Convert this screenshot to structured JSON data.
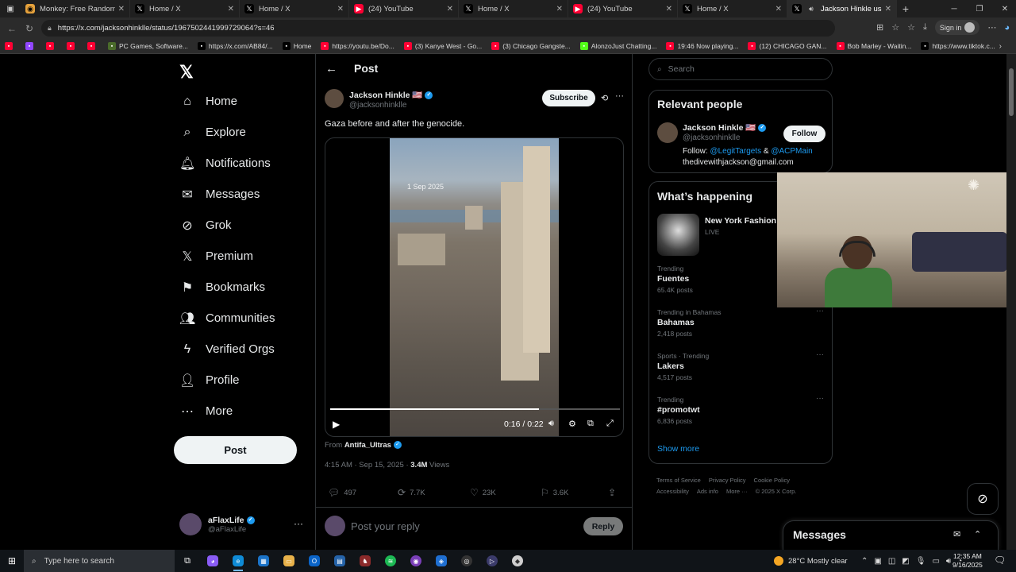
{
  "browser": {
    "tabs": [
      {
        "icon": "monkey-icon",
        "title": "Monkey: Free Random Vide",
        "active": false
      },
      {
        "icon": "x-icon",
        "title": "Home / X",
        "active": false
      },
      {
        "icon": "x-icon",
        "title": "Home / X",
        "active": false
      },
      {
        "icon": "youtube-icon",
        "title": "(24) YouTube",
        "active": false
      },
      {
        "icon": "x-icon",
        "title": "Home / X",
        "active": false
      },
      {
        "icon": "youtube-icon",
        "title": "(24) YouTube",
        "active": false
      },
      {
        "icon": "x-icon",
        "title": "Home / X",
        "active": false
      },
      {
        "icon": "x-icon",
        "title": "Jackson Hinkle us on X",
        "active": true
      }
    ],
    "url": "https://x.com/jacksonhinklle/status/1967502441999729064?s=46",
    "signin_label": "Sign in",
    "bookmarks": [
      {
        "label": "",
        "color": "#ff0033"
      },
      {
        "label": "",
        "color": "#9146ff"
      },
      {
        "label": "",
        "color": "#ff0033"
      },
      {
        "label": "",
        "color": "#ff0033"
      },
      {
        "label": "",
        "color": "#ff0033"
      },
      {
        "label": "PC Games, Software...",
        "color": "#4a6b2a"
      },
      {
        "label": "https://x.com/AB84/...",
        "color": "#000000"
      },
      {
        "label": "Home",
        "color": "#000000"
      },
      {
        "label": "https://youtu.be/Do...",
        "color": "#ff0033"
      },
      {
        "label": "(3) Kanye West - Go...",
        "color": "#ff0033"
      },
      {
        "label": "(3) Chicago Gangste...",
        "color": "#ff0033"
      },
      {
        "label": "AlonzoJust Chatting...",
        "color": "#53fc18"
      },
      {
        "label": "19:46 Now playing...",
        "color": "#ff0033"
      },
      {
        "label": "(12) CHICAGO GAN...",
        "color": "#ff0033"
      },
      {
        "label": "Bob Marley - Waitin...",
        "color": "#ff0033"
      },
      {
        "label": "https://www.tiktok.c...",
        "color": "#000000"
      }
    ]
  },
  "nav": {
    "items": [
      {
        "icon": "home-icon",
        "glyph": "⌂",
        "label": "Home"
      },
      {
        "icon": "explore-icon",
        "glyph": "⌕",
        "label": "Explore"
      },
      {
        "icon": "bell-icon",
        "glyph": "🔔︎",
        "label": "Notifications"
      },
      {
        "icon": "envelope-icon",
        "glyph": "✉",
        "label": "Messages"
      },
      {
        "icon": "grok-icon",
        "glyph": "⊘",
        "label": "Grok"
      },
      {
        "icon": "x-premium-icon",
        "glyph": "𝕏",
        "label": "Premium"
      },
      {
        "icon": "bookmark-icon",
        "glyph": "⚑",
        "label": "Bookmarks"
      },
      {
        "icon": "communities-icon",
        "glyph": "👥︎",
        "label": "Communities"
      },
      {
        "icon": "lightning-icon",
        "glyph": "ϟ",
        "label": "Verified Orgs"
      },
      {
        "icon": "profile-icon",
        "glyph": "👤︎",
        "label": "Profile"
      },
      {
        "icon": "more-icon",
        "glyph": "⋯",
        "label": "More"
      }
    ],
    "post_button": "Post",
    "account": {
      "name": "aFlaxLife",
      "handle": "@aFlaxLife"
    }
  },
  "post": {
    "header_title": "Post",
    "author_name": "Jackson Hinkle 🇺🇸",
    "author_handle": "@jacksonhinklle",
    "subscribe_label": "Subscribe",
    "text": "Gaza before and after the genocide.",
    "video": {
      "date_overlay": "1 Sep 2025",
      "time": "0:16 / 0:22",
      "progress": 0.72
    },
    "from_label": "From",
    "from_account": "Antifa_Ultras",
    "timestamp": "4:15 AM · Sep 15, 2025 ·",
    "views_count": "3.4M",
    "views_label": "Views",
    "replies": "497",
    "reposts": "7.7K",
    "likes": "23K",
    "bookmarks": "3.6K",
    "reply_placeholder": "Post your reply",
    "reply_button": "Reply"
  },
  "sidebar": {
    "search_placeholder": "Search",
    "relevant_title": "Relevant people",
    "relevant_person": {
      "name": "Jackson Hinkle 🇺🇸",
      "handle": "@jacksonhinklle",
      "follow_label": "Follow",
      "bio_prefix": "Follow:",
      "bio_link1": "@LegitTargets",
      "bio_amp": "&",
      "bio_link2": "@ACPMain",
      "bio_email": "thedivewithjackson@gmail.com"
    },
    "happening_title": "What’s happening",
    "event": {
      "name": "New York Fashion W",
      "status": "LIVE"
    },
    "trends": [
      {
        "category": "Trending",
        "name": "Fuentes",
        "count": "65.4K posts"
      },
      {
        "category": "Trending in Bahamas",
        "name": "Bahamas",
        "count": "2,418 posts"
      },
      {
        "category": "Sports · Trending",
        "name": "Lakers",
        "count": "4,517 posts"
      },
      {
        "category": "Trending",
        "name": "#promotwt",
        "count": "6,836 posts"
      }
    ],
    "show_more": "Show more",
    "footer": [
      "Terms of Service",
      "Privacy Policy",
      "Cookie Policy",
      "Accessibility",
      "Ads info",
      "More ···",
      "© 2025 X Corp."
    ]
  },
  "messages_drawer": {
    "title": "Messages"
  },
  "taskbar": {
    "search_placeholder": "Type here to search",
    "weather": "28°C  Mostly clear",
    "time": "12:35 AM",
    "date": "9/16/2025"
  }
}
